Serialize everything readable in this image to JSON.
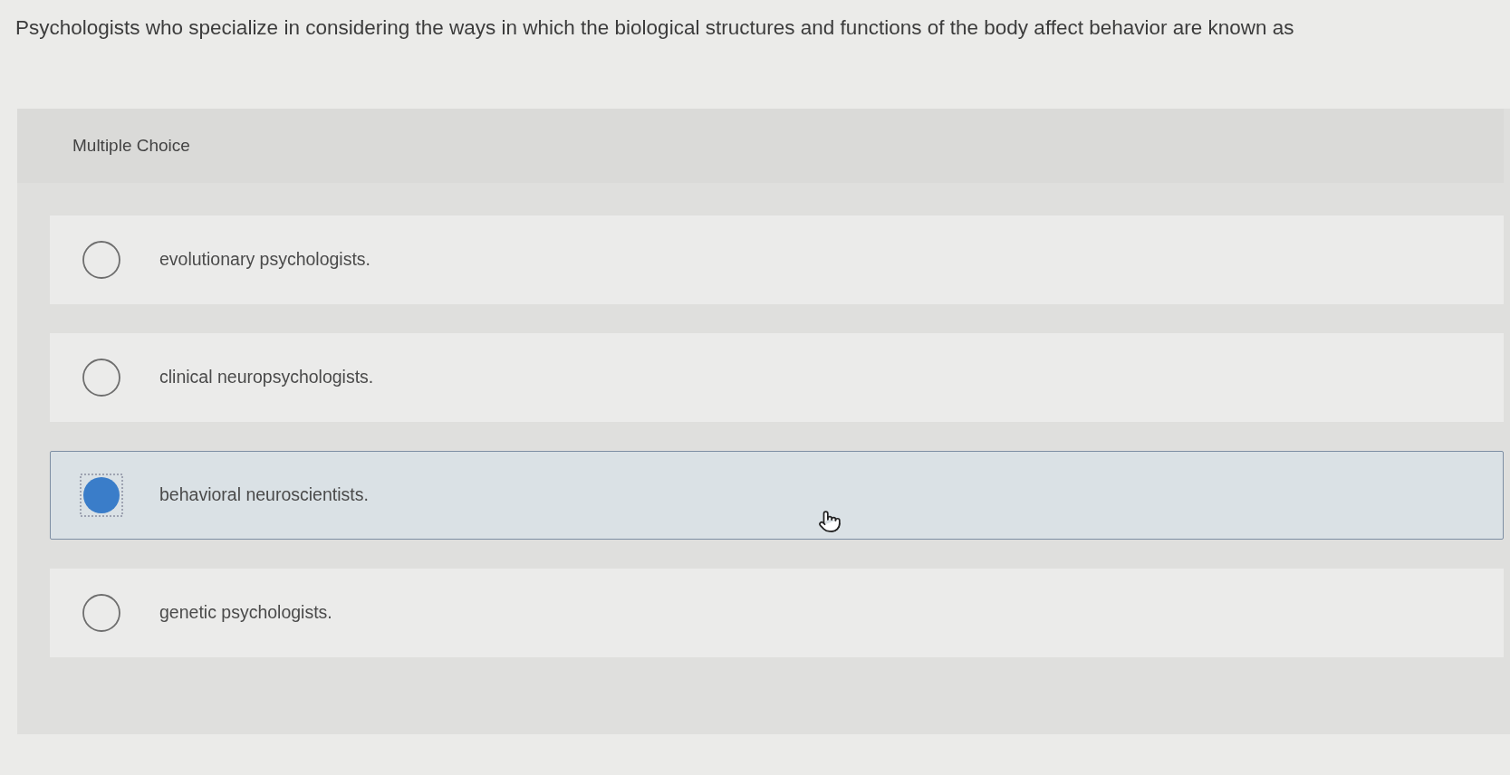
{
  "question": {
    "text": "Psychologists who specialize in considering the ways in which the biological structures and functions of the body affect behavior are known as"
  },
  "panel": {
    "label": "Multiple Choice",
    "options": [
      {
        "label": "evolutionary psychologists.",
        "selected": false
      },
      {
        "label": "clinical neuropsychologists.",
        "selected": false
      },
      {
        "label": "behavioral neuroscientists.",
        "selected": true
      },
      {
        "label": "genetic psychologists.",
        "selected": false
      }
    ]
  }
}
